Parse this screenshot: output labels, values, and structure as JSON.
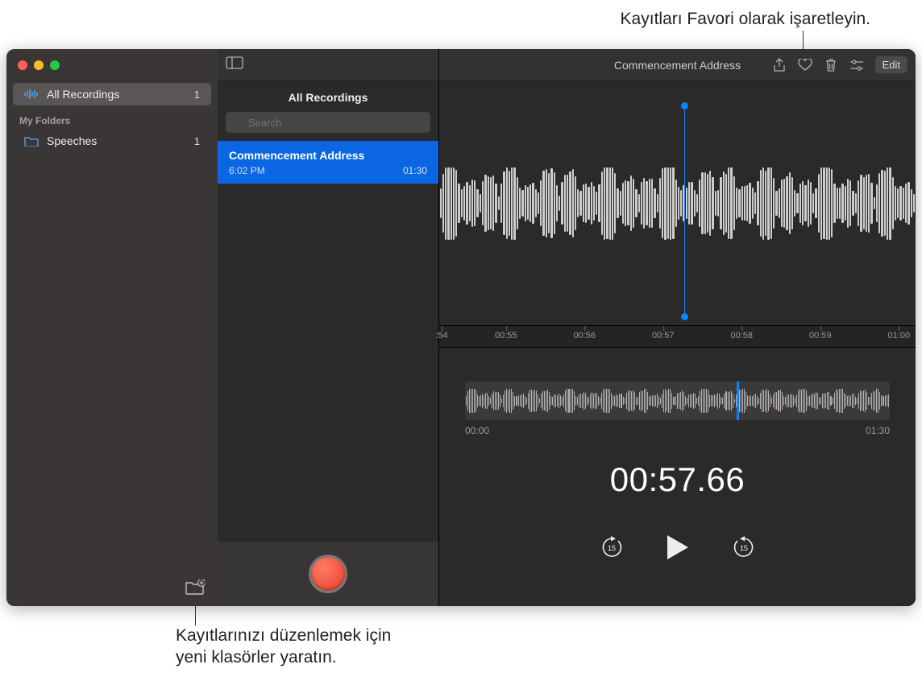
{
  "callouts": {
    "top": "Kayıtları Favori olarak işaretleyin.",
    "bottom_line1": "Kayıtlarınızı düzenlemek için",
    "bottom_line2": "yeni klasörler yaratın."
  },
  "sidebar": {
    "all_recordings": {
      "label": "All Recordings",
      "count": "1"
    },
    "section": "My Folders",
    "folders": [
      {
        "label": "Speeches",
        "count": "1"
      }
    ]
  },
  "list": {
    "title": "All Recordings",
    "search_placeholder": "Search",
    "items": [
      {
        "title": "Commencement Address",
        "time": "6:02 PM",
        "duration": "01:30"
      }
    ]
  },
  "detail": {
    "title": "Commencement Address",
    "edit_label": "Edit",
    "ruler": [
      ":54",
      "00:55",
      "00:56",
      "00:57",
      "00:58",
      "00:59",
      "01:00"
    ],
    "mini_start": "00:00",
    "mini_end": "01:30",
    "timer": "00:57.66",
    "skip_back": "15",
    "skip_fwd": "15"
  },
  "colors": {
    "accent": "#0a84ff",
    "selection": "#0a66e3",
    "record": "#e7402c"
  }
}
